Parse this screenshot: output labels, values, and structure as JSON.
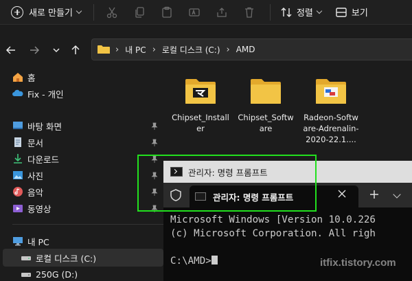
{
  "toolbar": {
    "new_label": "새로 만들기",
    "sort_label": "정렬",
    "view_label": "보기",
    "icons": [
      "cut-icon",
      "copy-icon",
      "paste-icon",
      "rename-icon",
      "share-icon",
      "delete-icon"
    ]
  },
  "address": {
    "crumbs": [
      "내 PC",
      "로컬 디스크 (C:)",
      "AMD"
    ]
  },
  "sidebar": {
    "home": "홈",
    "onedrive": "Fix - 개인",
    "quick": [
      "바탕 화면",
      "문서",
      "다운로드",
      "사진",
      "음악",
      "동영상"
    ],
    "this_pc": "내 PC",
    "drives": [
      "로컬 디스크 (C:)",
      "250G (D:)"
    ]
  },
  "files": [
    {
      "name": "Chipset_Installer",
      "type": "installer-folder"
    },
    {
      "name": "Chipset_Software",
      "type": "folder"
    },
    {
      "name": "Radeon-Software-Adrenalin-2020-22.1....",
      "type": "radeon-folder"
    }
  ],
  "cmd": {
    "window_title": "관리자: 명령 프롬프트",
    "tab_title": "관리자: 명령 프롬프트",
    "lines": [
      "Microsoft Windows [Version 10.0.226",
      "(c) Microsoft Corporation. All righ",
      "",
      "C:\\AMD>"
    ]
  },
  "watermark": "itfix.tistory.com",
  "colors": {
    "highlight": "#22e01e",
    "folder": "#f2c445",
    "background": "#1c1c1c"
  }
}
